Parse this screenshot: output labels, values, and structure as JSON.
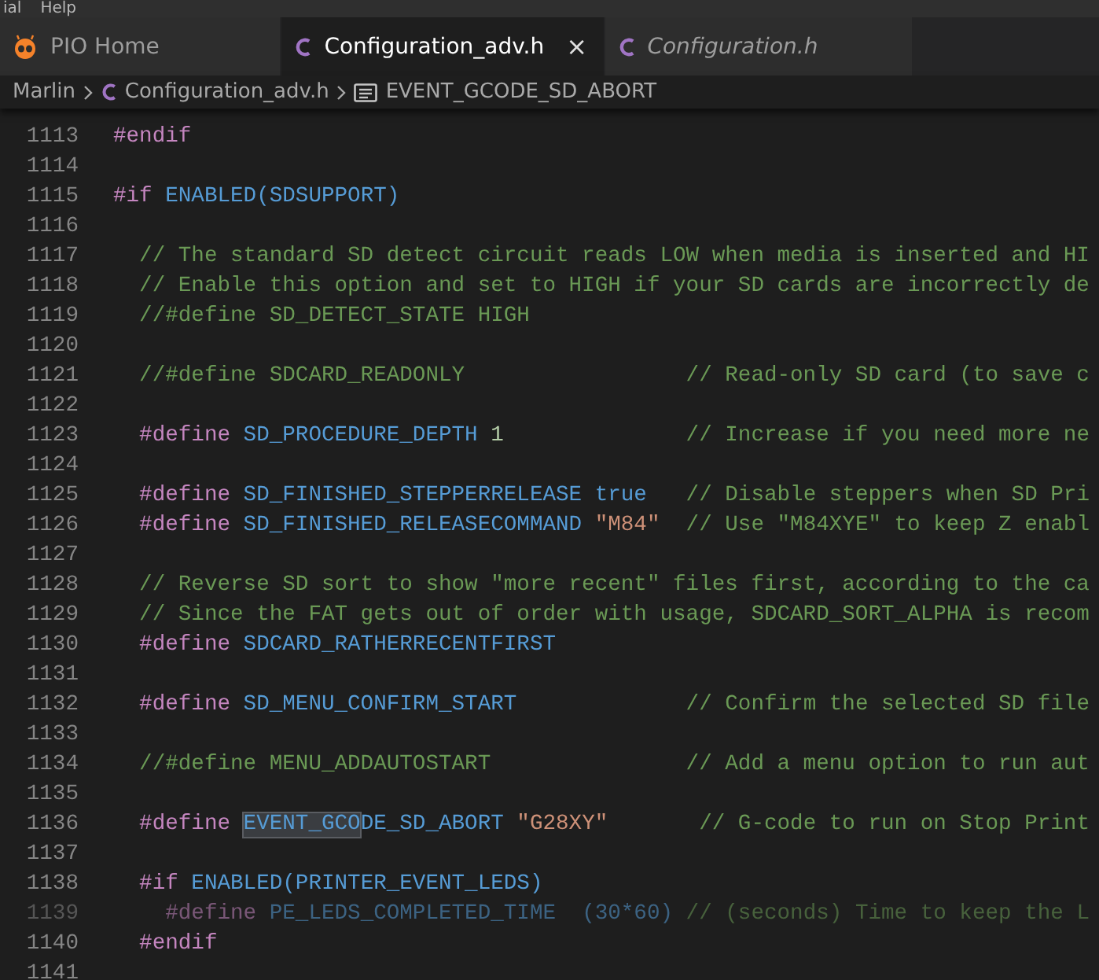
{
  "menu": [
    {
      "label": "ial"
    },
    {
      "label": "Help"
    }
  ],
  "tabs": [
    {
      "label": "PIO Home",
      "kind": "pio",
      "selected": false,
      "preview": false,
      "closable": false
    },
    {
      "label": "Configuration_adv.h",
      "kind": "c",
      "selected": true,
      "preview": false,
      "closable": true,
      "close": "×"
    },
    {
      "label": "Configuration.h",
      "kind": "c",
      "selected": false,
      "preview": true,
      "closable": false
    }
  ],
  "breadcrumb": [
    {
      "kind": "folder",
      "label": "Marlin"
    },
    {
      "kind": "file",
      "label": "Configuration_adv.h"
    },
    {
      "kind": "symbol",
      "label": "EVENT_GCODE_SD_ABORT"
    }
  ],
  "lines": [
    {
      "number": "1113",
      "inactive": false,
      "tokens": [
        {
          "kind": "directive",
          "text": "#endif"
        }
      ]
    },
    {
      "number": "1114",
      "inactive": false
    },
    {
      "number": "1115",
      "inactive": false,
      "tokens": [
        {
          "kind": "directive",
          "text": "#if"
        },
        {
          "kind": "name",
          "text": " ENABLED(SDSUPPORT)"
        }
      ]
    },
    {
      "number": "1116",
      "inactive": false
    },
    {
      "number": "1117",
      "inactive": false,
      "tokens": [
        {
          "kind": "comment",
          "text": "  // The standard SD detect circuit reads LOW when media is inserted and HI"
        }
      ]
    },
    {
      "number": "1118",
      "inactive": false,
      "tokens": [
        {
          "kind": "comment",
          "text": "  // Enable this option and set to HIGH if your SD cards are incorrectly de"
        }
      ]
    },
    {
      "number": "1119",
      "inactive": false,
      "tokens": [
        {
          "kind": "comment",
          "text": "  //#define SD_DETECT_STATE HIGH"
        }
      ]
    },
    {
      "number": "1120",
      "inactive": false
    },
    {
      "number": "1121",
      "inactive": false,
      "tokens": [
        {
          "kind": "comment",
          "text": "  //#define SDCARD_READONLY                 // Read-only SD card (to save c"
        }
      ]
    },
    {
      "number": "1122",
      "inactive": false
    },
    {
      "number": "1123",
      "inactive": false,
      "tokens": [
        {
          "kind": "directive",
          "text": "  #define"
        },
        {
          "kind": "name",
          "text": " SD_PROCEDURE_DEPTH"
        },
        {
          "kind": "number",
          "text": " 1"
        },
        {
          "kind": "comment",
          "text": "              // Increase if you need more ne"
        }
      ]
    },
    {
      "number": "1124",
      "inactive": false
    },
    {
      "number": "1125",
      "inactive": false,
      "tokens": [
        {
          "kind": "directive",
          "text": "  #define"
        },
        {
          "kind": "name",
          "text": " SD_FINISHED_STEPPERRELEASE"
        },
        {
          "kind": "keyword",
          "text": " true"
        },
        {
          "kind": "comment",
          "text": "   // Disable steppers when SD Pri"
        }
      ]
    },
    {
      "number": "1126",
      "inactive": false,
      "tokens": [
        {
          "kind": "directive",
          "text": "  #define"
        },
        {
          "kind": "name",
          "text": " SD_FINISHED_RELEASECOMMAND"
        },
        {
          "kind": "string",
          "text": " \"M84\""
        },
        {
          "kind": "comment",
          "text": "  // Use \"M84XYE\" to keep Z enabl"
        }
      ]
    },
    {
      "number": "1127",
      "inactive": false
    },
    {
      "number": "1128",
      "inactive": false,
      "tokens": [
        {
          "kind": "comment",
          "text": "  // Reverse SD sort to show \"more recent\" files first, according to the ca"
        }
      ]
    },
    {
      "number": "1129",
      "inactive": false,
      "tokens": [
        {
          "kind": "comment",
          "text": "  // Since the FAT gets out of order with usage, SDCARD_SORT_ALPHA is recom"
        }
      ]
    },
    {
      "number": "1130",
      "inactive": false,
      "tokens": [
        {
          "kind": "directive",
          "text": "  #define"
        },
        {
          "kind": "name",
          "text": " SDCARD_RATHERRECENTFIRST"
        }
      ]
    },
    {
      "number": "1131",
      "inactive": false
    },
    {
      "number": "1132",
      "inactive": false,
      "tokens": [
        {
          "kind": "directive",
          "text": "  #define"
        },
        {
          "kind": "name",
          "text": " SD_MENU_CONFIRM_START"
        },
        {
          "kind": "comment",
          "text": "             // Confirm the selected SD file"
        }
      ]
    },
    {
      "number": "1133",
      "inactive": false
    },
    {
      "number": "1134",
      "inactive": false,
      "tokens": [
        {
          "kind": "comment",
          "text": "  //#define MENU_ADDAUTOSTART               // Add a menu option to run aut"
        }
      ]
    },
    {
      "number": "1135",
      "inactive": false
    },
    {
      "number": "1136",
      "inactive": false,
      "tokens": [
        {
          "kind": "directive",
          "text": "  #define "
        },
        {
          "kind": "match",
          "text": "EVENT_GCO"
        },
        {
          "kind": "name",
          "text": "DE_SD_ABORT"
        },
        {
          "kind": "string",
          "text": " \"G28XY\""
        },
        {
          "kind": "comment",
          "text": "       // G-code to run on Stop Print"
        }
      ]
    },
    {
      "number": "1137",
      "inactive": false
    },
    {
      "number": "1138",
      "inactive": false,
      "tokens": [
        {
          "kind": "directive",
          "text": "  #if"
        },
        {
          "kind": "name",
          "text": " ENABLED(PRINTER_EVENT_LEDS)"
        }
      ]
    },
    {
      "number": "1139",
      "inactive": true,
      "tokens": [
        {
          "kind": "directive",
          "text": "    #define"
        },
        {
          "kind": "name",
          "text": " PE_LEDS_COMPLETED_TIME  (30*60)"
        },
        {
          "kind": "comment",
          "text": " // (seconds) Time to keep the L"
        }
      ]
    },
    {
      "number": "1140",
      "inactive": false,
      "tokens": [
        {
          "kind": "directive",
          "text": "  #endif"
        }
      ]
    },
    {
      "number": "1141",
      "inactive": false
    }
  ]
}
